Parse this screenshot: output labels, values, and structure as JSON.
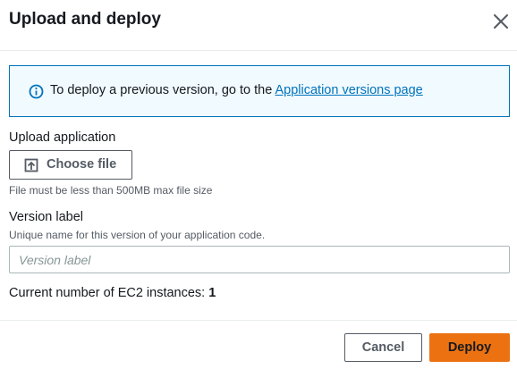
{
  "modal": {
    "title": "Upload and deploy",
    "close_icon": "close-icon"
  },
  "info": {
    "icon": "info-icon",
    "text": "To deploy a previous version, go to the ",
    "link_text": "Application versions page"
  },
  "upload": {
    "label": "Upload application",
    "button_icon": "upload-icon",
    "button_label": "Choose file",
    "hint": "File must be less than 500MB max file size"
  },
  "version": {
    "label": "Version label",
    "description": "Unique name for this version of your application code.",
    "placeholder": "Version label",
    "value": ""
  },
  "instances": {
    "label": "Current number of EC2 instances:",
    "count": "1"
  },
  "footer": {
    "cancel_label": "Cancel",
    "deploy_label": "Deploy"
  },
  "colors": {
    "accent": "#ec7211",
    "link": "#0073bb",
    "info_bg": "#f1faff"
  }
}
